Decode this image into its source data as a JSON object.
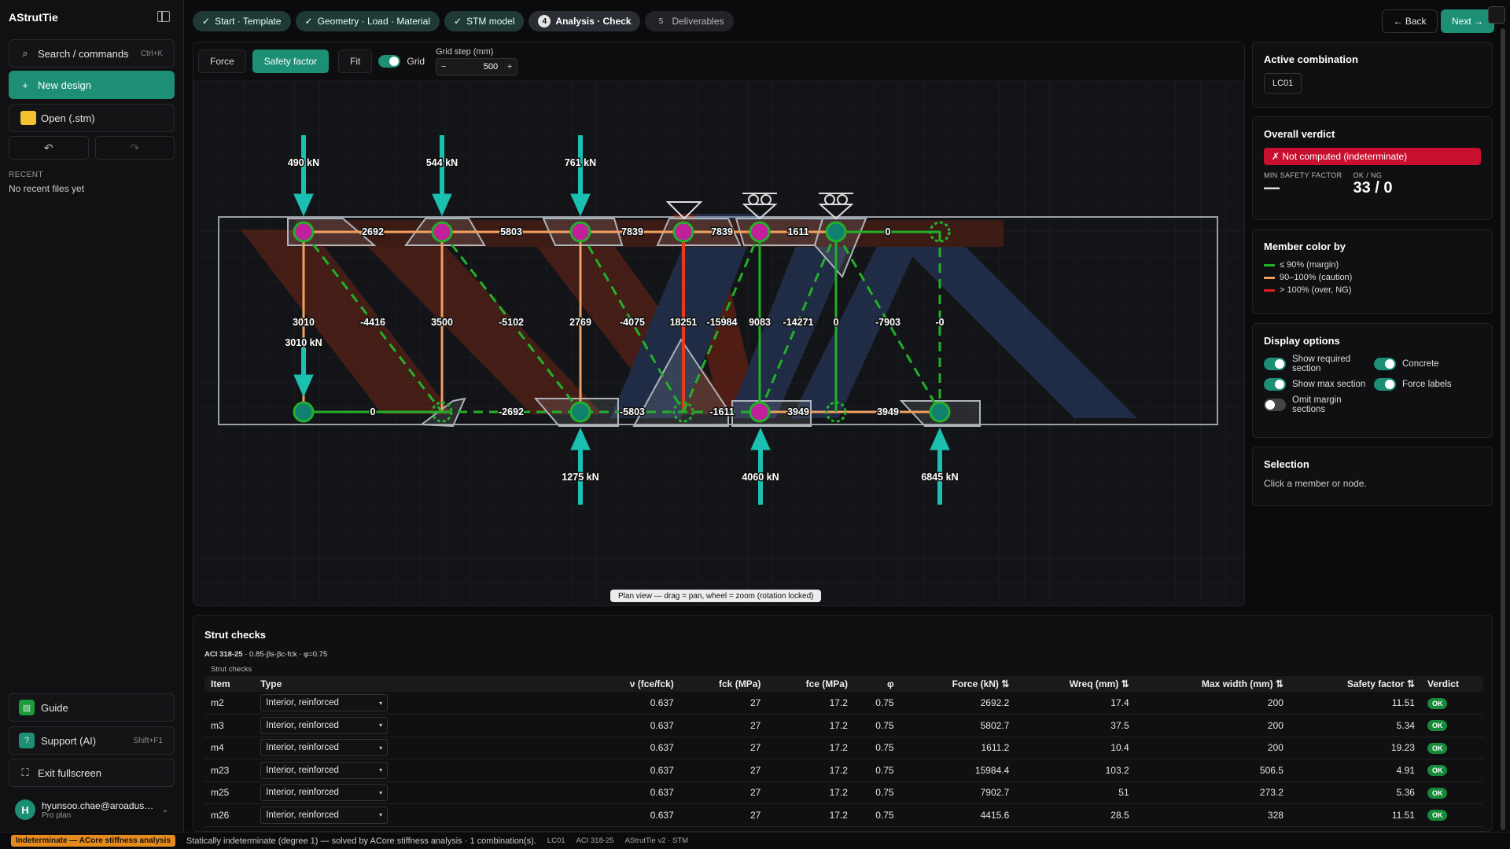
{
  "app": {
    "title": "AStrutTie"
  },
  "sidebar": {
    "search_label": "Search / commands",
    "search_shortcut": "Ctrl+K",
    "new_design": "New design",
    "open": "Open (.stm)",
    "recent_title": "RECENT",
    "recent_empty": "No recent files yet",
    "guide": "Guide",
    "support": "Support (AI)",
    "support_shortcut": "Shift+F1",
    "exit_fullscreen": "Exit fullscreen",
    "user_email": "hyunsoo.chae@aroadus…",
    "user_plan": "Pro plan",
    "user_initial": "H"
  },
  "steps": [
    {
      "label": "Start · Template",
      "state": "done",
      "mark": "✓"
    },
    {
      "label": "Geometry · Load · Material",
      "state": "done",
      "mark": "✓"
    },
    {
      "label": "STM model",
      "state": "done",
      "mark": "✓"
    },
    {
      "label": "Analysis · Check",
      "state": "active",
      "mark": "4"
    },
    {
      "label": "Deliverables",
      "state": "future",
      "mark": "5"
    }
  ],
  "nav": {
    "back": "← Back",
    "next": "Next →"
  },
  "toolbar": {
    "force": "Force",
    "safety": "Safety factor",
    "fit": "Fit",
    "grid": "Grid",
    "gridstep_label": "Grid step (mm)",
    "gridstep_value": "500",
    "minus": "−",
    "plus": "+"
  },
  "canvas": {
    "hint": "Plan view — drag = pan, wheel = zoom (rotation locked)",
    "loads_top": [
      "490 kN",
      "544 kN",
      "761 kN"
    ],
    "load_left": "3010 kN",
    "reactions": [
      "1275 kN",
      "4060 kN",
      "6845 kN"
    ],
    "top_chord": [
      "2692",
      "5803",
      "7839",
      "7839",
      "1611",
      "0"
    ],
    "bottom_chord": [
      "0",
      "-2692",
      "-5803",
      "-1611",
      "3949",
      "3949"
    ],
    "web": [
      "3010",
      "-4416",
      "3500",
      "-5102",
      "2769",
      "-4075",
      "18251",
      "-15984",
      "9083",
      "-14271",
      "0",
      "-7903",
      "-0"
    ]
  },
  "panels": {
    "active_combination": {
      "title": "Active combination",
      "value": "LC01"
    },
    "verdict": {
      "title": "Overall verdict",
      "status": "✗ Not computed (indeterminate)",
      "min_sf_label": "MIN SAFETY FACTOR",
      "min_sf_value": "—",
      "okng_label": "OK / NG",
      "okng_value": "33 / 0"
    },
    "member_color": {
      "title": "Member color by",
      "items": [
        {
          "label": "≤ 90% (margin)",
          "color": "#22b02a"
        },
        {
          "label": "90–100% (caution)",
          "color": "#f0a060"
        },
        {
          "label": "> 100% (over, NG)",
          "color": "#e02020"
        }
      ]
    },
    "display": {
      "title": "Display options",
      "show_required": "Show required section",
      "show_max": "Show max section",
      "omit_margin": "Omit margin sections",
      "concrete": "Concrete",
      "force_labels": "Force labels"
    },
    "selection": {
      "title": "Selection",
      "hint": "Click a member or node."
    }
  },
  "table": {
    "title": "Strut checks",
    "code": "ACI 318-25",
    "formula": "0.85·βs·βc·fck · φ=0.75",
    "subtitle": "Strut checks",
    "columns": [
      "Item",
      "Type",
      "ν (fce/fck)",
      "fck (MPa)",
      "fce (MPa)",
      "φ",
      "Force (kN) ⇅",
      "Wreq (mm) ⇅",
      "Max width (mm) ⇅",
      "Safety factor ⇅",
      "Verdict"
    ],
    "rows": [
      [
        "m2",
        "Interior, reinforced",
        "0.637",
        "27",
        "17.2",
        "0.75",
        "2692.2",
        "17.4",
        "200",
        "11.51",
        "OK"
      ],
      [
        "m3",
        "Interior, reinforced",
        "0.637",
        "27",
        "17.2",
        "0.75",
        "5802.7",
        "37.5",
        "200",
        "5.34",
        "OK"
      ],
      [
        "m4",
        "Interior, reinforced",
        "0.637",
        "27",
        "17.2",
        "0.75",
        "1611.2",
        "10.4",
        "200",
        "19.23",
        "OK"
      ],
      [
        "m23",
        "Interior, reinforced",
        "0.637",
        "27",
        "17.2",
        "0.75",
        "15984.4",
        "103.2",
        "506.5",
        "4.91",
        "OK"
      ],
      [
        "m25",
        "Interior, reinforced",
        "0.637",
        "27",
        "17.2",
        "0.75",
        "7902.7",
        "51",
        "273.2",
        "5.36",
        "OK"
      ],
      [
        "m26",
        "Interior, reinforced",
        "0.637",
        "27",
        "17.2",
        "0.75",
        "4415.6",
        "28.5",
        "328",
        "11.51",
        "OK"
      ]
    ]
  },
  "status": {
    "badge": "Indeterminate — ACore stiffness analysis",
    "message": "Statically indeterminate (degree 1) — solved by ACore stiffness analysis · 1 combination(s).",
    "combo": "LC01",
    "code": "ACI 318-25",
    "version": "AStrutTie v2 · STM"
  },
  "colors": {
    "accent": "#1c8f74",
    "strut": "#22b02a",
    "tie": "#f0a060",
    "node_magenta": "#c0209a",
    "node_teal": "#128070",
    "load": "#1cc0b0"
  }
}
